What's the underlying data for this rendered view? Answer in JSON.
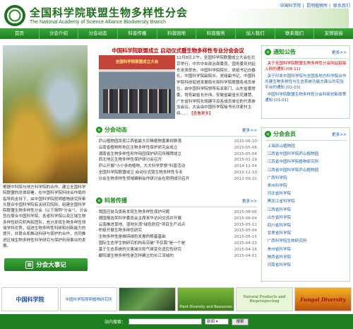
{
  "header": {
    "title_cn": "全国科学院联盟生物多样性分会",
    "title_en": "The National Academy of Science Alliance Biodiversity Branch",
    "top_links": [
      "中国科学院",
      "昆明植物所",
      "联系我们"
    ]
  },
  "nav": [
    "首页",
    "分会介绍",
    "分会动态",
    "科普传播",
    "科普园地",
    "科普服务",
    "加入我们",
    "联系我们",
    "友情链接"
  ],
  "headline": "中国科学院联盟成立 启动仪式暨生物多样性专业分会会议",
  "news_photo_banner": "全国科学院联盟成立大会",
  "news_text": "12月8日上午，全国科学院联盟成立大会在北京举行，中共中央政治局委员、国务委员刘延东发来贺信，中国科学院院长、党组书记白春礼，中国科学院副院长、党组副书记，中国科学院科技促进发展局长和科学院联盟各成员单位，由中国科学院领导有关部门，山东省委常委、常务副省长孙伟，安徽省副省长花建慧、广东省科学院长胡建平及各成员单位的代表参加会议。大会由中国科学院秘书长邓麦村主持......",
  "news_more": "【查看更多】",
  "intro_text": "根据中科院与地方科学院的合作，建立全国科学院联盟的总体部署，在中国科学院科技合作局的指导和支持下，由中国科学院昆明植物研究所牵头联合中国科学院有关研究院所，组建全国科学院联盟生物多样性分会（以下简称\"分会\"）。分会旨在联合中国科学院、各省科学院以及区域生物多样性研究机构和团队，充分发挥生物多样性领域学科优势，促进生物多样性科研和创新能力的提升，并联合和推动科研与保护的合作，共同推进区域生物多样性科学研究与保护利用事业的发展。",
  "events_button": "分会大事记",
  "branch_news": {
    "title": "分会动态",
    "more": "更多>>",
    "items": [
      {
        "t": "庐山植物园发现江西省最大珍稀植物香果树群落",
        "d": "2015-06-10"
      },
      {
        "t": "云南省植物所地区生物多样性保护研究会成立",
        "d": "2015-05-06"
      },
      {
        "t": "湖南省生物多样性和作用园保护研究所揭牌成立",
        "d": "2015-05-04"
      },
      {
        "t": "西北地区生物多样性保护研讨会召开",
        "d": "2015-01-19"
      },
      {
        "t": "庐山开展\"小小多肉植物，大大科学梦想\"科普活动",
        "d": "2014-12-04"
      },
      {
        "t": "全国科学院联盟成立 启动仪式暨生物多样性专业",
        "d": "2013-12-10"
      },
      {
        "t": "分会生物多样性领域编制会作研讨会在昆明成功召开",
        "d": "2012-09-21"
      }
    ]
  },
  "popular_science": {
    "title": "科普传播",
    "more": "更多>>",
    "items": [
      {
        "t": "我国迁徙鸟类新发现生物多样性保护问题",
        "d": "2015-08-06"
      },
      {
        "t": "德国报告奖科学委员会主席来华访问交流并开展",
        "d": "2015-06-04"
      },
      {
        "t": "云南推进草地、湿地水湾\"绿色防控\"项目生产试点",
        "d": "2015-05-11"
      },
      {
        "t": "积极开展生物多样性研究",
        "d": "2015-05-04"
      },
      {
        "t": "生物多样性是维持绿色发展的根基基础",
        "d": "2015-05-15"
      },
      {
        "t": "国际生态学生物研究机构有突破\"不仅需\"是一个是",
        "d": "2015-04-23"
      },
      {
        "t": "基于生态系统的灾害减灾和气候变化适应性研究",
        "d": "2015-04-16"
      },
      {
        "t": "鄱阳湖生物多样性是怎样确立的长江流域的",
        "d": "2015-04-01"
      }
    ]
  },
  "notices": {
    "title": "通知公告",
    "more": "更多>>",
    "items": [
      {
        "text": "关于全国科学院联盟生物多样性分会网站链接入网的通知 [08-11]",
        "highlight": true
      },
      {
        "text": "关于印发中国科学院与全国各地方科学院合作共建生物多样性与生态系统功能方面公共实验平台的通知 [02-03]",
        "highlight": false
      },
      {
        "text": "中国科学院联盟生物多样性分会科研创新政策通知 [01-01]",
        "highlight": false
      }
    ]
  },
  "members": {
    "title": "分会会员",
    "more": "更多>>",
    "items": [
      "上海辰山植物园",
      "江西省中国科学院庐山植物园",
      "江苏省中国科学院植物研究所",
      "江西省中国科学院庐山植物园",
      "广西科学院",
      "贵州科学院",
      "河北省科学院",
      "黑龙江省科学院",
      "江西省科学院",
      "山东省科学院",
      "四川省科学院",
      "甘肃省科学院",
      "广西科学院生物研究所",
      "贵州省科学院",
      "陕西省科学院",
      "河南省科学院"
    ]
  },
  "partner_logos": [
    "中国科学院",
    "中国科学院昆明植物研究所",
    "",
    "Plant Diversity and Resources",
    "Natural Products and Bioprospecting",
    "Fungal Diversity"
  ],
  "search": {
    "label": "站内搜索：",
    "select": "新闻",
    "button": "搜索"
  },
  "colors": {
    "brand_green": "#1e7f1e",
    "headline_red": "#c00000",
    "link_blue": "#1f5fa0"
  }
}
